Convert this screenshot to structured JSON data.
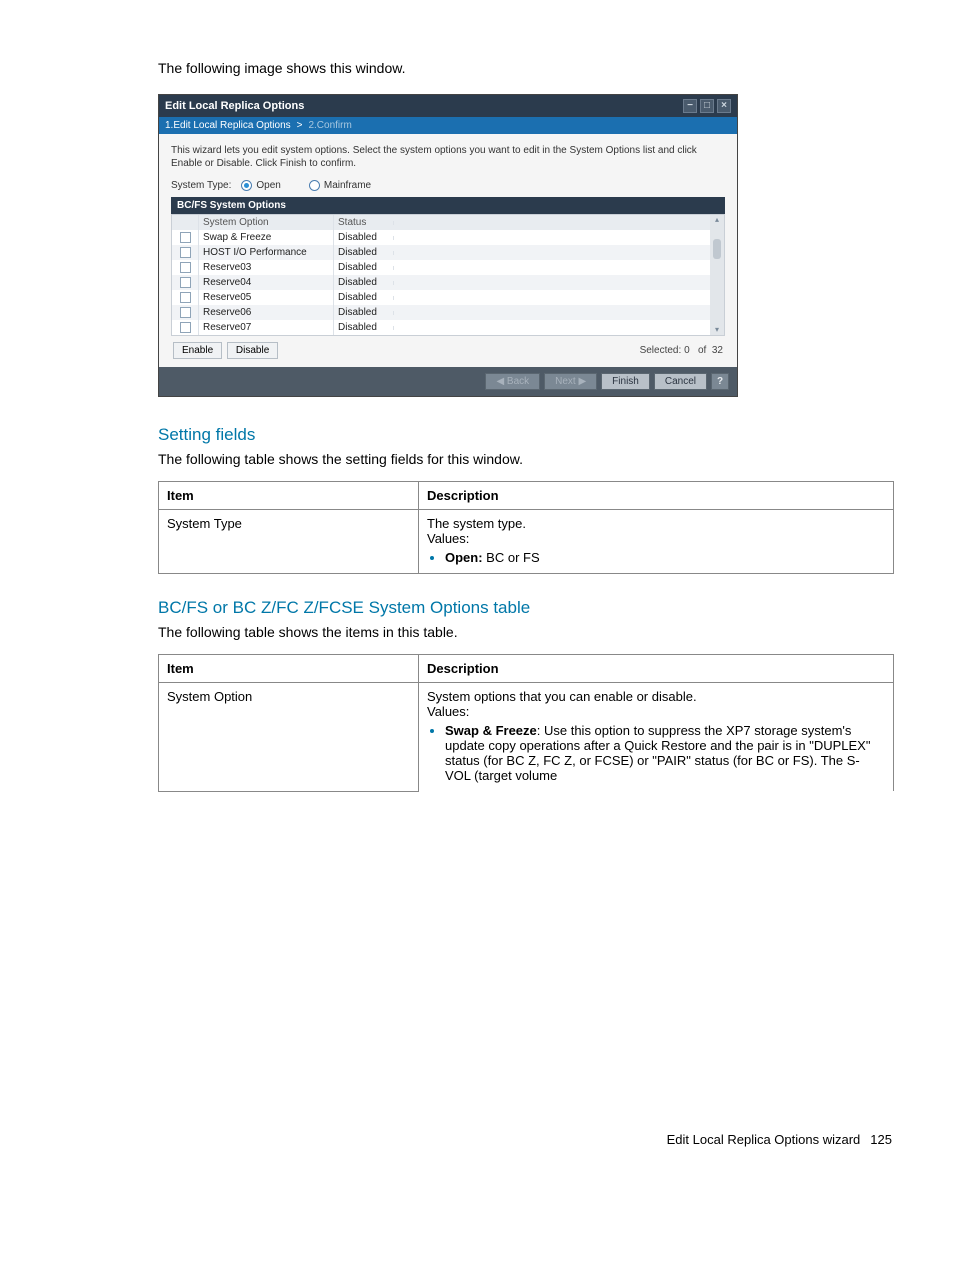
{
  "intro": "The following image shows this window.",
  "dialog": {
    "title": "Edit Local Replica Options",
    "breadcrumb": {
      "step1": "1.Edit Local Replica Options",
      "sep": ">",
      "step2": "2.Confirm"
    },
    "description": "This wizard lets you edit system options. Select the system options you want to edit in the System Options list and click Enable or Disable. Click Finish to confirm.",
    "systemTypeLabel": "System Type:",
    "radioOpen": "Open",
    "radioMainframe": "Mainframe",
    "tableTitle": "BC/FS System Options",
    "columns": {
      "name": "System Option",
      "status": "Status"
    },
    "rows": [
      {
        "name": "Swap & Freeze",
        "status": "Disabled"
      },
      {
        "name": "HOST I/O Performance",
        "status": "Disabled"
      },
      {
        "name": "Reserve03",
        "status": "Disabled"
      },
      {
        "name": "Reserve04",
        "status": "Disabled"
      },
      {
        "name": "Reserve05",
        "status": "Disabled"
      },
      {
        "name": "Reserve06",
        "status": "Disabled"
      },
      {
        "name": "Reserve07",
        "status": "Disabled"
      }
    ],
    "enableBtn": "Enable",
    "disableBtn": "Disable",
    "selectedLabel": "Selected:",
    "selectedCount": "0",
    "ofLabel": "of",
    "totalCount": "32",
    "footer": {
      "back": "◀ Back",
      "next": "Next ▶",
      "finish": "Finish",
      "cancel": "Cancel",
      "help": "?"
    }
  },
  "section1": {
    "heading": "Setting fields",
    "text": "The following table shows the setting fields for this window.",
    "th1": "Item",
    "th2": "Description",
    "row1_item": "System Type",
    "row1_desc1": "The system type.",
    "row1_desc2": "Values:",
    "row1_bullet_bold": "Open:",
    "row1_bullet_rest": " BC or FS"
  },
  "section2": {
    "heading": "BC/FS or BC Z/FC Z/FCSE System Options table",
    "text": "The following table shows the items in this table.",
    "th1": "Item",
    "th2": "Description",
    "row1_item": "System Option",
    "row1_desc1": "System options that you can enable or disable.",
    "row1_desc2": "Values:",
    "row1_bullet_bold": "Swap & Freeze",
    "row1_bullet_rest": ": Use this option to suppress the XP7 storage system's update copy operations after a Quick Restore and the pair is in \"DUPLEX\" status (for BC Z, FC Z, or FCSE) or \"PAIR\" status (for BC or FS). The S-VOL (target volume"
  },
  "footer": {
    "text": "Edit Local Replica Options wizard",
    "page": "125"
  }
}
